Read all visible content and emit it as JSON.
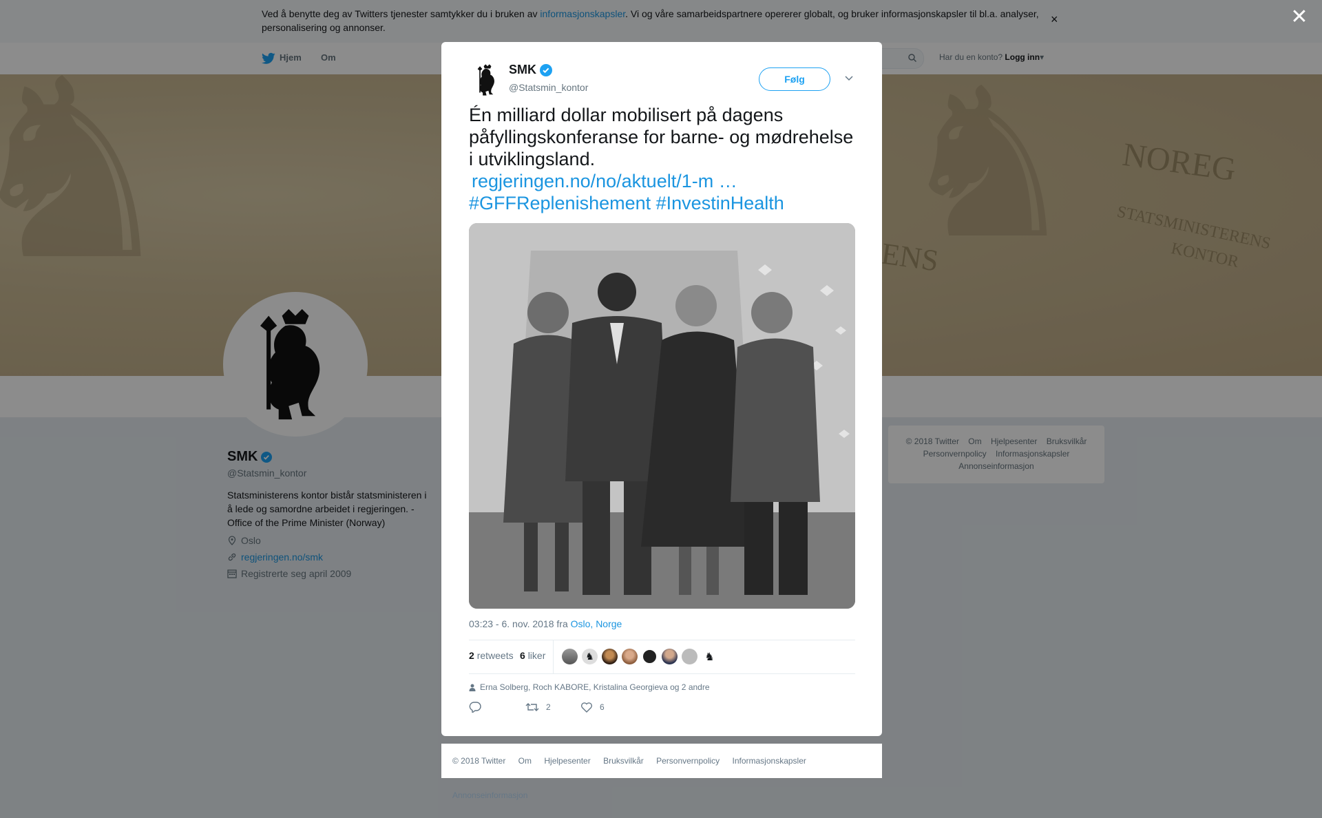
{
  "cookie_bar": {
    "text_before": "Ved å benytte deg av Twitters tjenester samtykker du i bruken av ",
    "link": "informasjonskapsler",
    "text_after": ". Vi og våre samarbeidspartnere opererer globalt, og bruker informasjonskapsler til bl.a. analyser, personalisering og annonser.",
    "close": "×"
  },
  "nav": {
    "home": "Hjem",
    "about": "Om",
    "have_account": "Har du en konto?",
    "login": "Logg inn"
  },
  "banner": {
    "word1": "NOREG",
    "word2": "STATSMINISTERENS",
    "word3": "KONTOR",
    "word4": "ENS"
  },
  "profile": {
    "name": "SMK",
    "handle": "@Statsmin_kontor",
    "bio": "Statsministerens kontor bistår statsministeren i å lede og samordne arbeidet i regjeringen. - Office of the Prime Minister (Norway)",
    "location": "Oslo",
    "website": "regjeringen.no/smk",
    "joined": "Registrerte seg april 2009"
  },
  "right_card": {
    "items_row1": [
      "© 2018 Twitter",
      "Om",
      "Hjelpesenter",
      "Bruksvilkår"
    ],
    "items_row2": [
      "Personvernpolicy",
      "Informasjonskapsler"
    ],
    "items_row3": [
      "Annonseinformasjon"
    ]
  },
  "overlay": {
    "close": "✕"
  },
  "tweet": {
    "name": "SMK",
    "handle": "@Statsmin_kontor",
    "follow": "Følg",
    "text": "Én milliard dollar mobilisert på dagens påfyllingskonferanse for barne- og mødrehelse i utviklingsland.",
    "link": "regjeringen.no/no/aktuelt/1-m  …",
    "hashtag1": "#GFFReplenishement",
    "hashtag2": "#InvestinHealth",
    "time": "03:23 - 6. nov. 2018 fra ",
    "place": "Oslo, Norge",
    "retweets_count": "2",
    "retweets_label": "retweets",
    "likes_count": "6",
    "likes_label": "liker",
    "reply_context": "Erna Solberg, Roch KABORE, Kristalina Georgieva og 2 andre",
    "action_retweets": "2",
    "action_likes": "6"
  },
  "modal_footer": {
    "items": [
      "© 2018 Twitter",
      "Om",
      "Hjelpesenter",
      "Bruksvilkår",
      "Personvernpolicy",
      "Informasjonskapsler",
      "Annonseinformasjon"
    ]
  },
  "colors": {
    "accent": "#1da1f2",
    "link": "#1b95e0",
    "verified": "#1da1f2"
  }
}
